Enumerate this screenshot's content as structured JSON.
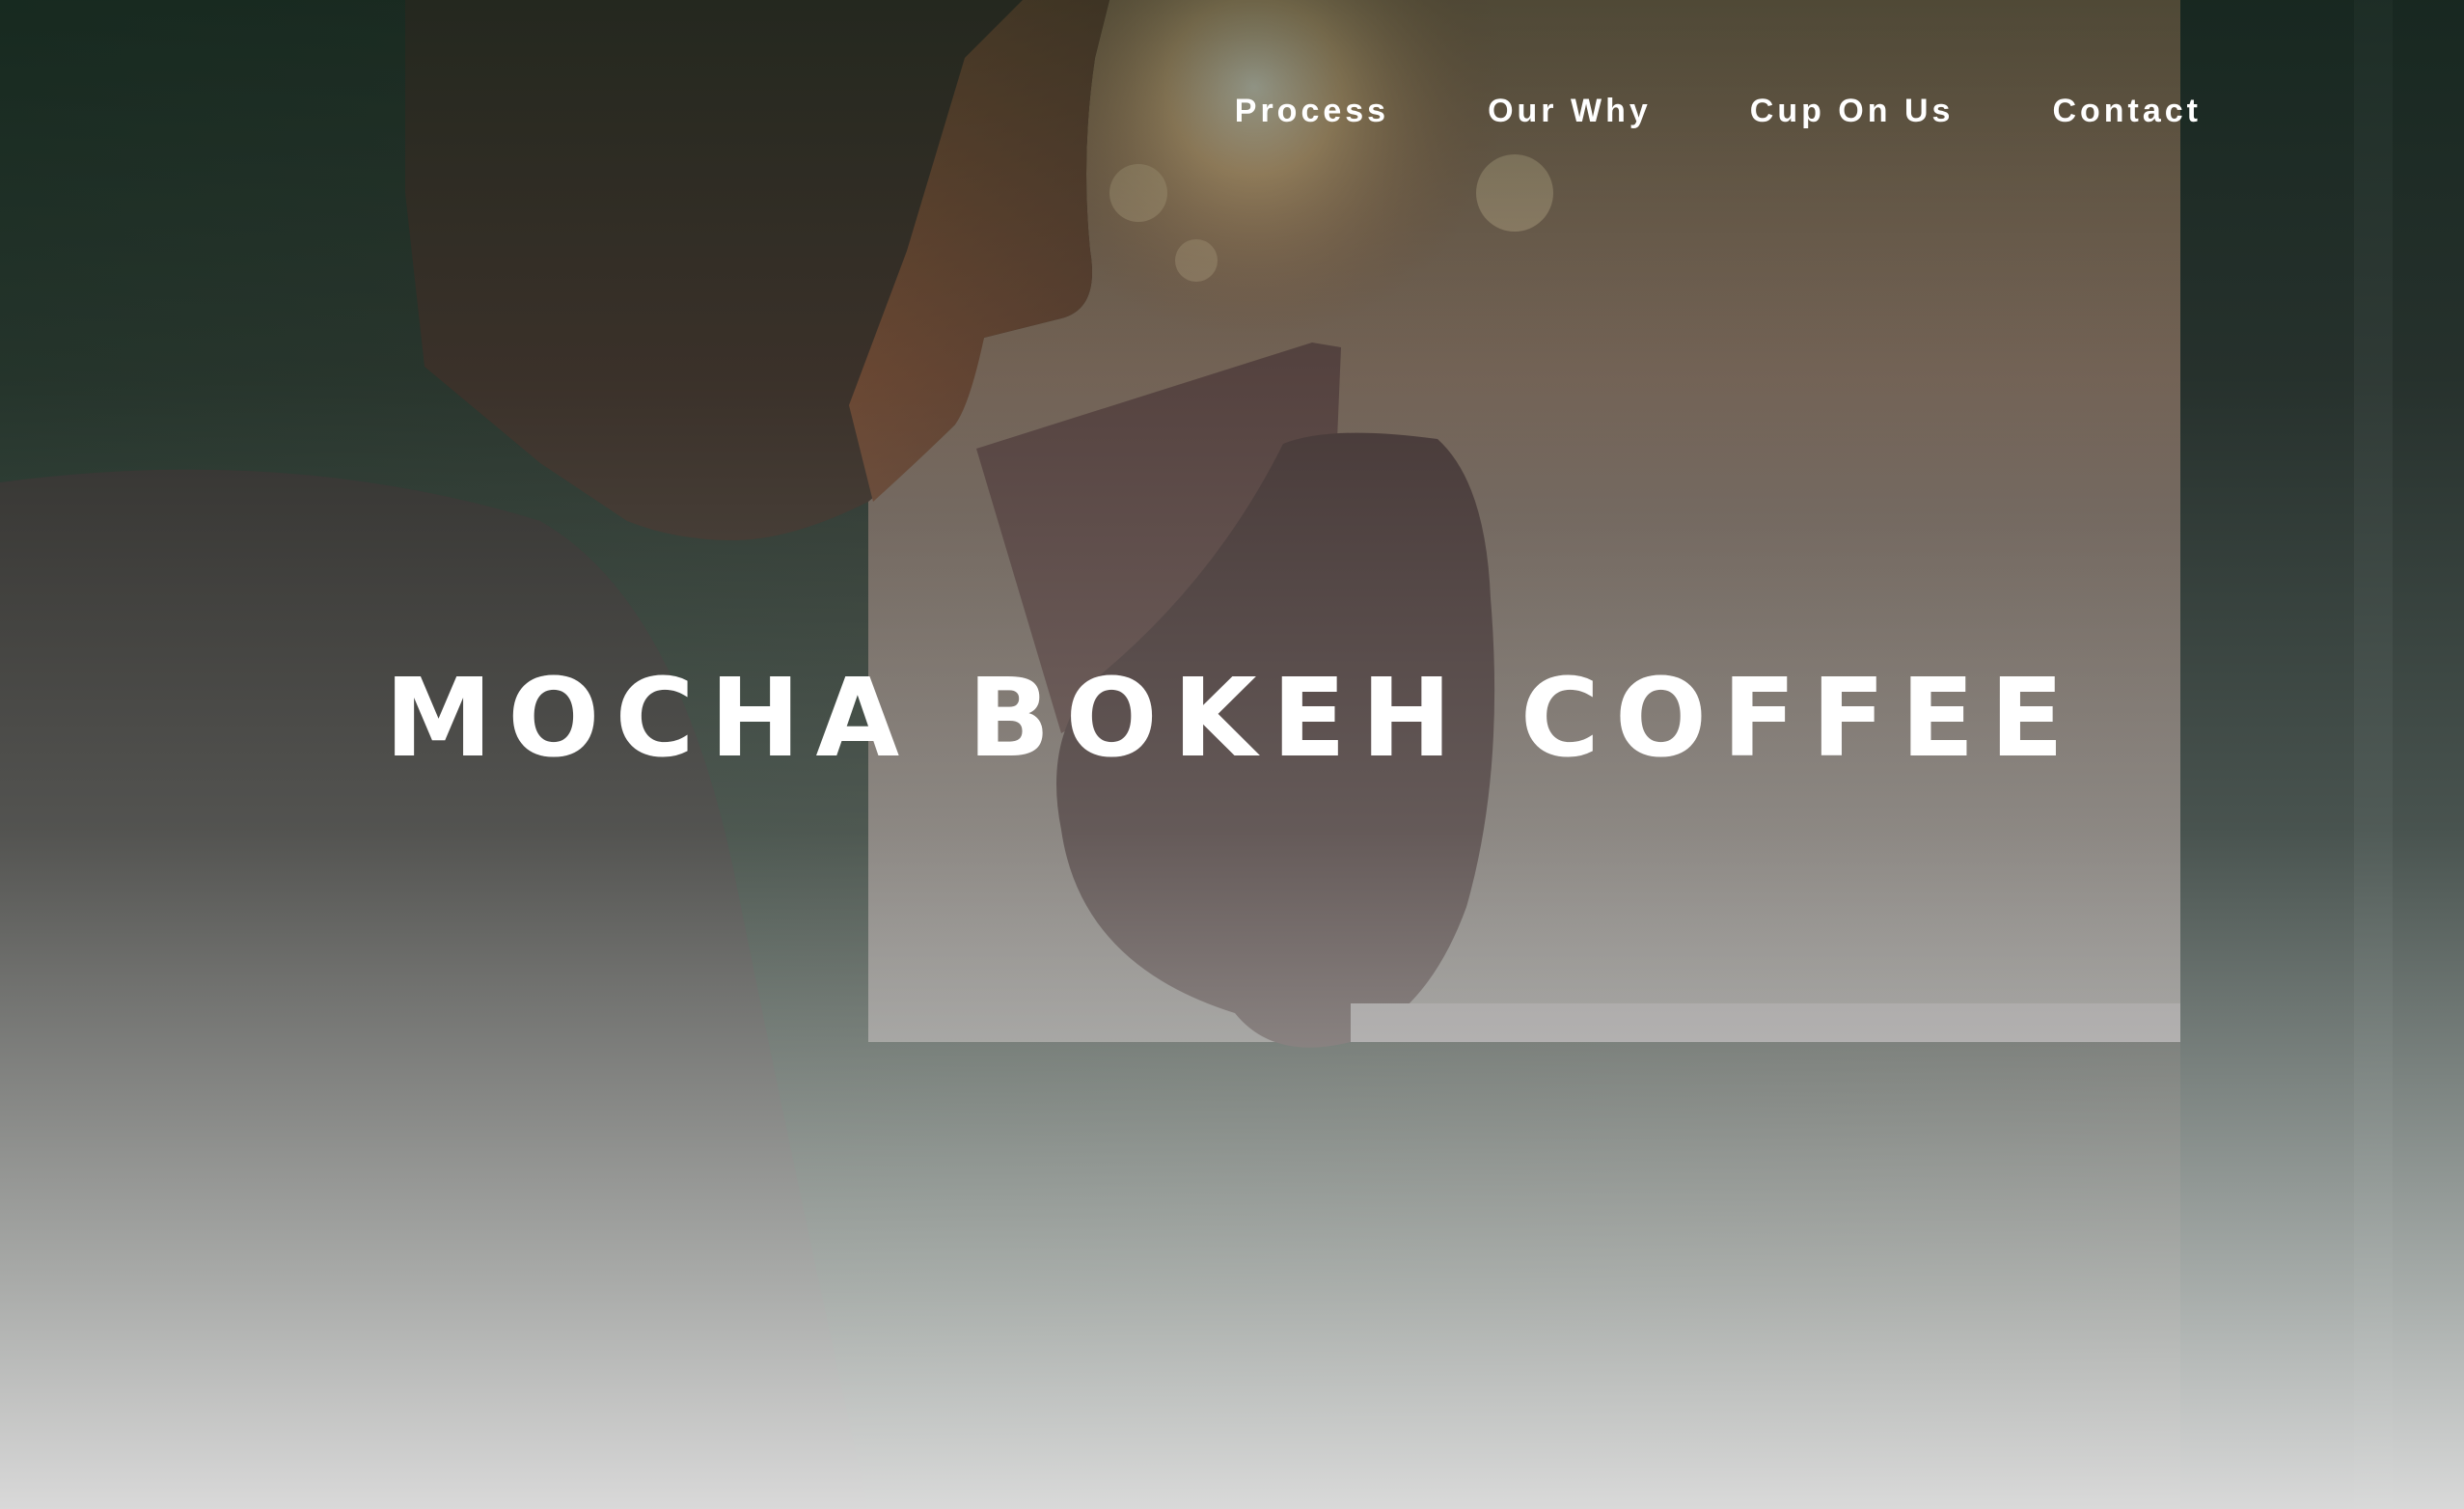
{
  "site": {
    "title": "MOCHA BOKEH COFFEE"
  },
  "nav": {
    "items": [
      {
        "label": "Process"
      },
      {
        "label": "Our Why"
      },
      {
        "label": "Cup On Us"
      },
      {
        "label": "Contact"
      }
    ]
  },
  "colors": {
    "text": "#ffffff",
    "overlay_top": "#12261c",
    "overlay_bottom": "#e0e0e0"
  },
  "hero_image": {
    "subject": "person-drinking-coffee-by-window"
  }
}
